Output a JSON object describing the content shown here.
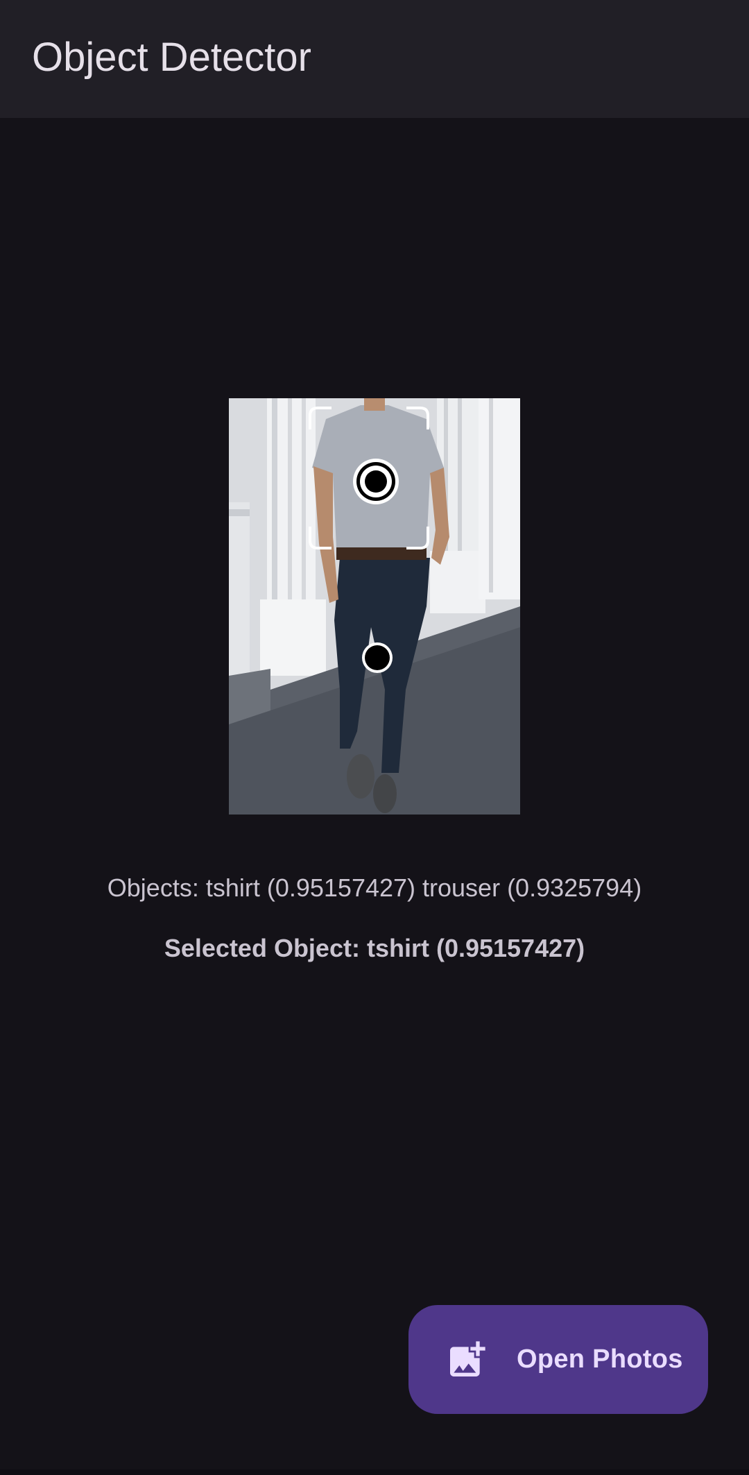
{
  "app": {
    "title": "Object Detector"
  },
  "detection": {
    "objects_text": "Objects: tshirt (0.95157427) trouser (0.9325794)",
    "selected_text": "Selected Object: tshirt (0.95157427)",
    "objects": [
      {
        "label": "tshirt",
        "score": 0.95157427,
        "selected": true
      },
      {
        "label": "trouser",
        "score": 0.9325794,
        "selected": false
      }
    ]
  },
  "fab": {
    "label": "Open Photos",
    "icon": "add-photo-icon"
  },
  "colors": {
    "background": "#141218",
    "topbar": "#211f26",
    "fab_background": "#4f378a",
    "fab_text": "#eaddff",
    "text": "#cac4d0"
  }
}
